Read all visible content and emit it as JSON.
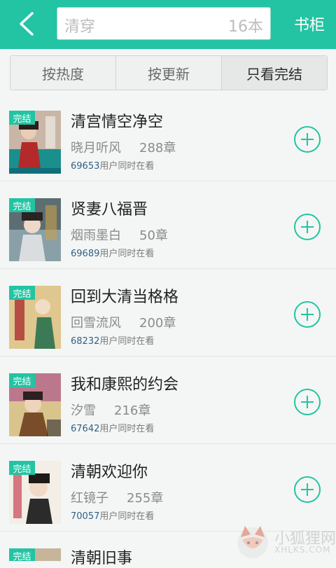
{
  "header": {
    "back_icon": "chevron-left-icon",
    "search_query": "清穿",
    "search_count": "16本",
    "shelf_label": "书柜",
    "accent_color": "#22c4a3"
  },
  "filters": {
    "tabs": [
      {
        "label": "按热度"
      },
      {
        "label": "按更新"
      },
      {
        "label": "只看完结"
      }
    ],
    "active": "只看完结"
  },
  "books": [
    {
      "badge": "完结",
      "title": "清宫情空净空",
      "author": "晓月听风",
      "chapters": "288章",
      "readers": "69653",
      "readers_suffix": "用户同时在看"
    },
    {
      "badge": "完结",
      "title": "贤妻八福晋",
      "author": "烟雨墨白",
      "chapters": "50章",
      "readers": "69689",
      "readers_suffix": "用户同时在看"
    },
    {
      "badge": "完结",
      "title": "回到大清当格格",
      "author": "回雪流风",
      "chapters": "200章",
      "readers": "68232",
      "readers_suffix": "用户同时在看"
    },
    {
      "badge": "完结",
      "title": "我和康熙的约会",
      "author": "汐雪",
      "chapters": "216章",
      "readers": "67642",
      "readers_suffix": "用户同时在看"
    },
    {
      "badge": "完结",
      "title": "清朝欢迎你",
      "author": "红镜子",
      "chapters": "255章",
      "readers": "70057",
      "readers_suffix": "用户同时在看"
    },
    {
      "badge": "完结",
      "title": "清朝旧事",
      "author": "",
      "chapters": "",
      "readers": "",
      "readers_suffix": ""
    }
  ],
  "watermark": {
    "title": "小狐狸网",
    "url": "XHLKS.COM"
  }
}
